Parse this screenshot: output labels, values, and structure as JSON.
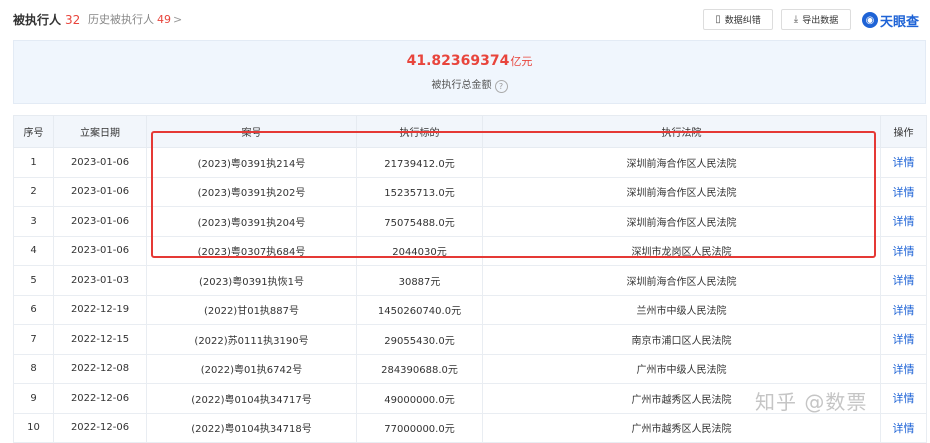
{
  "header": {
    "current_tab": {
      "label": "被执行人",
      "count": "32"
    },
    "history_tab": {
      "label": "历史被执行人",
      "count": "49",
      "chevron": ">"
    },
    "buttons": {
      "correct_label": "数据纠错",
      "export_label": "导出数据"
    },
    "logo_text": "天眼查"
  },
  "summary": {
    "amount": "41.82369374",
    "unit": "亿元",
    "label": "被执行总金额"
  },
  "table": {
    "columns": [
      "序号",
      "立案日期",
      "案号",
      "执行标的",
      "执行法院",
      "操作"
    ],
    "rows": [
      {
        "no": "1",
        "date": "2023-01-06",
        "case_no": "(2023)粤0391执214号",
        "amount": "21739412.0元",
        "court": "深圳前海合作区人民法院",
        "action": "详情"
      },
      {
        "no": "2",
        "date": "2023-01-06",
        "case_no": "(2023)粤0391执202号",
        "amount": "15235713.0元",
        "court": "深圳前海合作区人民法院",
        "action": "详情"
      },
      {
        "no": "3",
        "date": "2023-01-06",
        "case_no": "(2023)粤0391执204号",
        "amount": "75075488.0元",
        "court": "深圳前海合作区人民法院",
        "action": "详情"
      },
      {
        "no": "4",
        "date": "2023-01-06",
        "case_no": "(2023)粤0307执684号",
        "amount": "2044030元",
        "court": "深圳市龙岗区人民法院",
        "action": "详情"
      },
      {
        "no": "5",
        "date": "2023-01-03",
        "case_no": "(2023)粤0391执恢1号",
        "amount": "30887元",
        "court": "深圳前海合作区人民法院",
        "action": "详情"
      },
      {
        "no": "6",
        "date": "2022-12-19",
        "case_no": "(2022)甘01执887号",
        "amount": "1450260740.0元",
        "court": "兰州市中级人民法院",
        "action": "详情"
      },
      {
        "no": "7",
        "date": "2022-12-15",
        "case_no": "(2022)苏0111执3190号",
        "amount": "29055430.0元",
        "court": "南京市浦口区人民法院",
        "action": "详情"
      },
      {
        "no": "8",
        "date": "2022-12-08",
        "case_no": "(2022)粤01执6742号",
        "amount": "284390688.0元",
        "court": "广州市中级人民法院",
        "action": "详情"
      },
      {
        "no": "9",
        "date": "2022-12-06",
        "case_no": "(2022)粤0104执34717号",
        "amount": "49000000.0元",
        "court": "广州市越秀区人民法院",
        "action": "详情"
      },
      {
        "no": "10",
        "date": "2022-12-06",
        "case_no": "(2022)粤0104执34718号",
        "amount": "77000000.0元",
        "court": "广州市越秀区人民法院",
        "action": "详情"
      }
    ]
  },
  "watermark": "知乎 @数票",
  "colors": {
    "accent_red": "#e8453c",
    "link_blue": "#1e63d6",
    "highlight_box": "#e53935"
  }
}
